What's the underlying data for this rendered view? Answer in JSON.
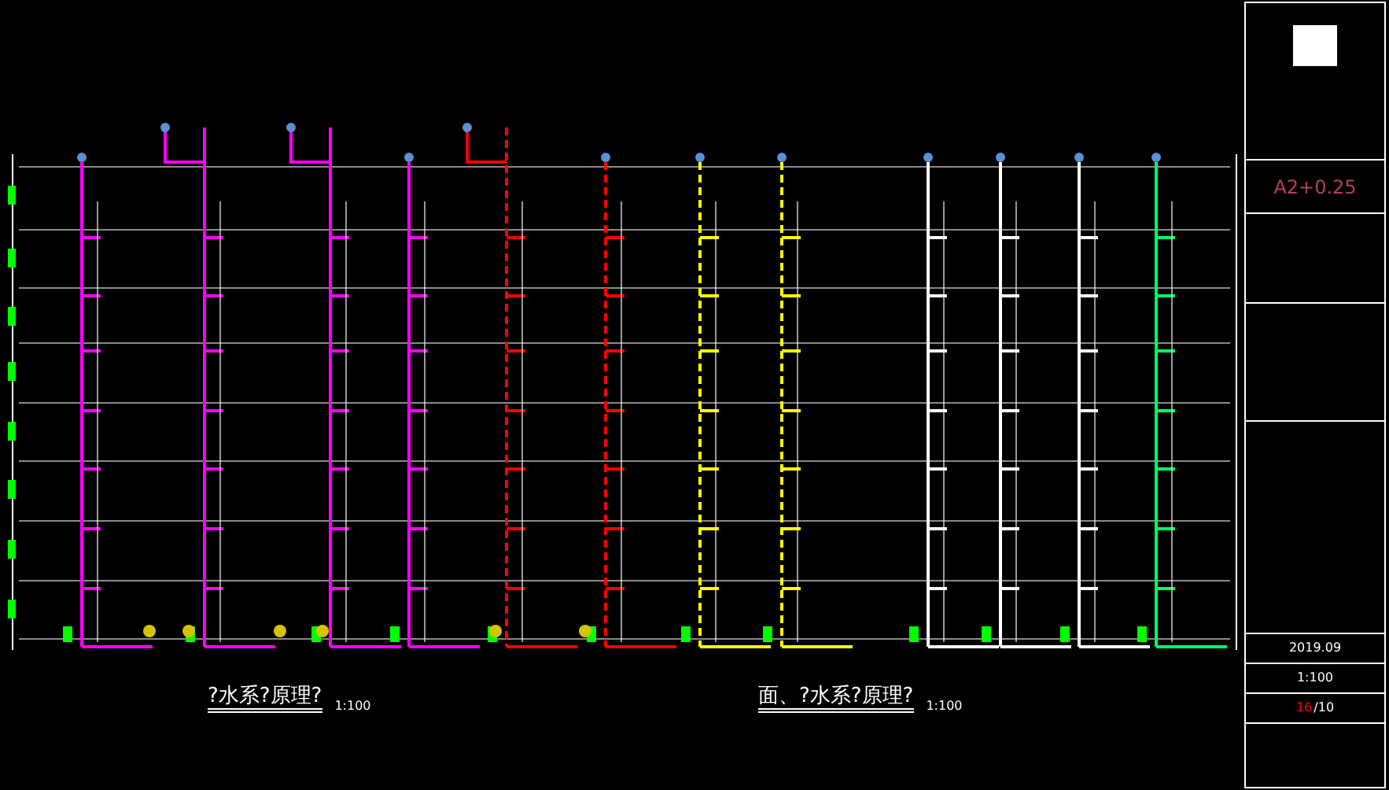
{
  "drawing_titles": [
    {
      "text": "?水系?原理?",
      "scale": "1:100"
    },
    {
      "text": "面、?水系?原理?",
      "scale": "1:100"
    }
  ],
  "title_block": {
    "size": "A2+0.25",
    "date": "2019.09",
    "scale": "1:100",
    "sheet_no": "16",
    "sheet_total": "/10"
  }
}
